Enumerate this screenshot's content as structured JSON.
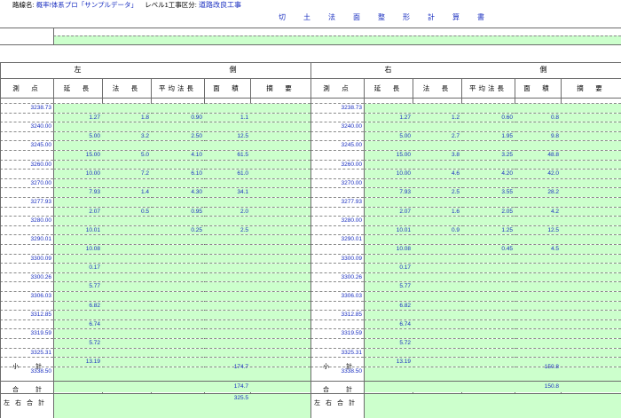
{
  "header": {
    "label": "路線名:",
    "route": "概率!体系プロ「サンプルデータ」",
    "level": "レベル1工事区分:",
    "project": "道路改良工事"
  },
  "title": "切土法面整形計算書",
  "left": {
    "title_a": "左",
    "title_b": "側",
    "headers": [
      "測　点",
      "延　長",
      "法　長",
      "平均法長",
      "面　積",
      "摘　要"
    ],
    "stations": [
      "3238.73",
      "3240.00",
      "3245.00",
      "3260.00",
      "3270.00",
      "3277.93",
      "3280.00",
      "3290.01",
      "3300.09",
      "3300.26",
      "3306.03",
      "3312.85",
      "3319.59",
      "3325.31",
      "3338.50"
    ],
    "rows": [
      {
        "len": "1.27",
        "slope": "1.8",
        "avg": "0.90",
        "area": "1.1"
      },
      {
        "len": "5.00",
        "slope": "3.2",
        "avg": "2.50",
        "area": "12.5"
      },
      {
        "len": "15.00",
        "slope": "5.0",
        "avg": "4.10",
        "area": "61.5"
      },
      {
        "len": "10.00",
        "slope": "7.2",
        "avg": "6.10",
        "area": "61.0"
      },
      {
        "len": "7.93",
        "slope": "1.4",
        "avg": "4.30",
        "area": "34.1"
      },
      {
        "len": "2.07",
        "slope": "0.5",
        "avg": "0.95",
        "area": "2.0"
      },
      {
        "len": "10.01",
        "slope": "",
        "avg": "0.25",
        "area": "2.5"
      },
      {
        "len": "10.08",
        "slope": "",
        "avg": "",
        "area": ""
      },
      {
        "len": "0.17",
        "slope": "",
        "avg": "",
        "area": ""
      },
      {
        "len": "5.77",
        "slope": "",
        "avg": "",
        "area": ""
      },
      {
        "len": "6.82",
        "slope": "",
        "avg": "",
        "area": ""
      },
      {
        "len": "6.74",
        "slope": "",
        "avg": "",
        "area": ""
      },
      {
        "len": "5.72",
        "slope": "",
        "avg": "",
        "area": ""
      },
      {
        "len": "13.19",
        "slope": "",
        "avg": "",
        "area": ""
      }
    ],
    "subtotal": "174.7",
    "total": "174.7",
    "grand": "325.5"
  },
  "right": {
    "title_a": "右",
    "title_b": "側",
    "headers": [
      "測　点",
      "延　長",
      "法　長",
      "平均法長",
      "面　積",
      "摘　要"
    ],
    "stations": [
      "3238.73",
      "3240.00",
      "3245.00",
      "3260.00",
      "3270.00",
      "3277.93",
      "3280.00",
      "3290.01",
      "3300.09",
      "3300.26",
      "3306.03",
      "3312.85",
      "3319.59",
      "3325.31",
      "3338.50"
    ],
    "rows": [
      {
        "len": "1.27",
        "slope": "1.2",
        "avg": "0.60",
        "area": "0.8"
      },
      {
        "len": "5.00",
        "slope": "2.7",
        "avg": "1.95",
        "area": "9.8"
      },
      {
        "len": "15.00",
        "slope": "3.8",
        "avg": "3.25",
        "area": "48.8"
      },
      {
        "len": "10.00",
        "slope": "4.6",
        "avg": "4.20",
        "area": "42.0"
      },
      {
        "len": "7.93",
        "slope": "2.5",
        "avg": "3.55",
        "area": "28.2"
      },
      {
        "len": "2.07",
        "slope": "1.6",
        "avg": "2.05",
        "area": "4.2"
      },
      {
        "len": "10.01",
        "slope": "0.9",
        "avg": "1.25",
        "area": "12.5"
      },
      {
        "len": "10.08",
        "slope": "",
        "avg": "0.45",
        "area": "4.5"
      },
      {
        "len": "0.17",
        "slope": "",
        "avg": "",
        "area": ""
      },
      {
        "len": "5.77",
        "slope": "",
        "avg": "",
        "area": ""
      },
      {
        "len": "6.82",
        "slope": "",
        "avg": "",
        "area": ""
      },
      {
        "len": "6.74",
        "slope": "",
        "avg": "",
        "area": ""
      },
      {
        "len": "5.72",
        "slope": "",
        "avg": "",
        "area": ""
      },
      {
        "len": "13.19",
        "slope": "",
        "avg": "",
        "area": ""
      }
    ],
    "subtotal": "150.8",
    "total": "150.8"
  },
  "footer": {
    "subtotal_label": "小　計",
    "total_label": "合　計",
    "grand_label": "左右合計"
  }
}
